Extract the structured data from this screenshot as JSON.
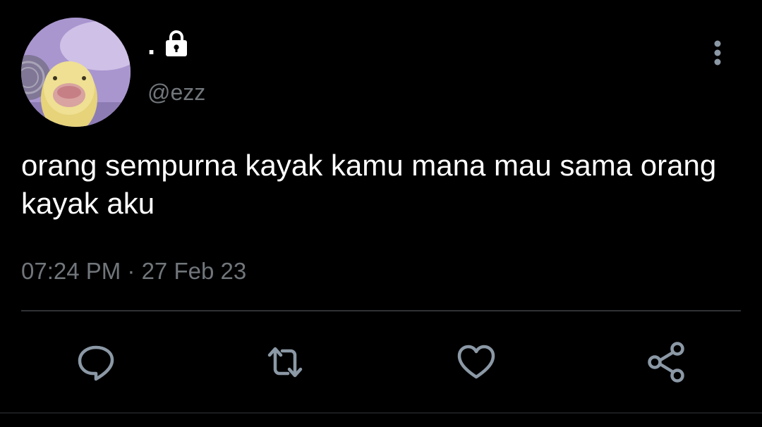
{
  "tweet": {
    "display_name": ".",
    "handle": "@ezz",
    "text": "orang sempurna kayak kamu mana mau sama orang kayak aku",
    "time": "07:24 PM",
    "separator": " · ",
    "date": "27 Feb 23"
  },
  "icons": {
    "lock": "lock-icon",
    "more": "more-vertical-icon",
    "reply": "reply-icon",
    "retweet": "retweet-icon",
    "like": "heart-icon",
    "share": "share-icon"
  },
  "colors": {
    "background": "#000000",
    "text": "#ffffff",
    "secondary": "#71767b",
    "divider": "#2f3336",
    "icon": "#8b98a5"
  }
}
